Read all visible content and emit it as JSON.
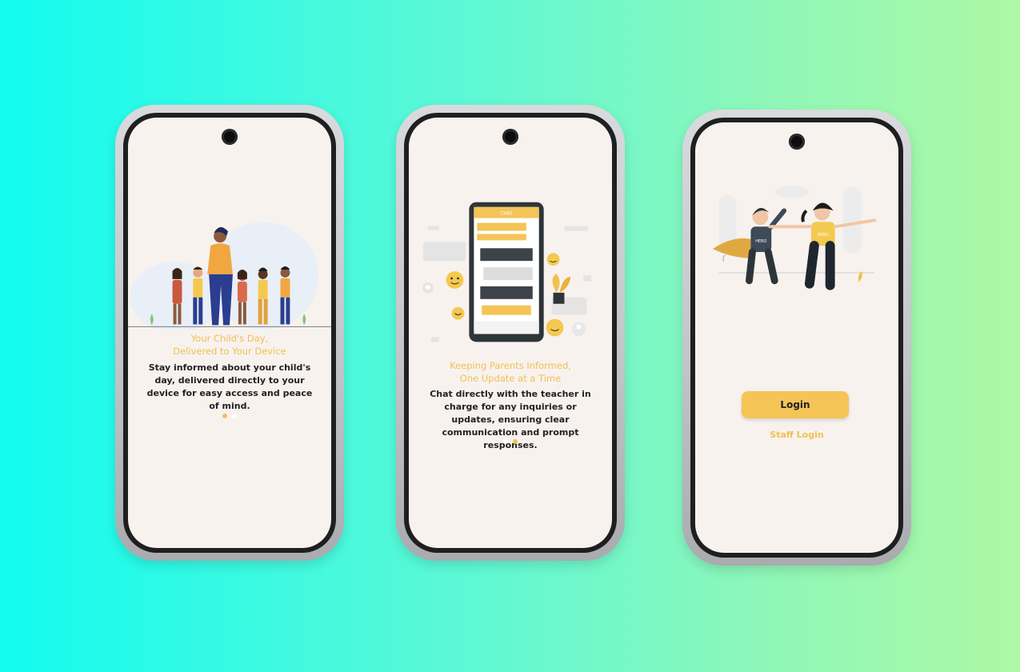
{
  "screens": [
    {
      "title_line1": "Your Child's Day,",
      "title_line2": "Delivered to Your Device",
      "description": "Stay informed about your child's day, delivered directly to your device for easy  access and peace of mind.",
      "page_indicator": {
        "active": 1,
        "total": 2
      }
    },
    {
      "chat_header": "CHAT",
      "title_line1": "Keeping Parents Informed,",
      "title_line2": "One Update at a Time",
      "description": "Chat directly with the teacher in charge for  any inquiries or updates, ensuring clear communication and prompt responses.",
      "page_indicator": {
        "active": 2,
        "total": 2
      }
    },
    {
      "shirt_text": "HERO",
      "login_label": "Login",
      "staff_login_label": "Staff Login"
    }
  ],
  "colors": {
    "accent": "#f4c457",
    "screen_bg": "#f8f2ef",
    "title_color": "#f0c14e",
    "body_text": "#222222"
  },
  "icons": [
    "camera-icon",
    "emoji-icon",
    "heart-icon",
    "like-icon",
    "user-icon",
    "plant-icon"
  ]
}
